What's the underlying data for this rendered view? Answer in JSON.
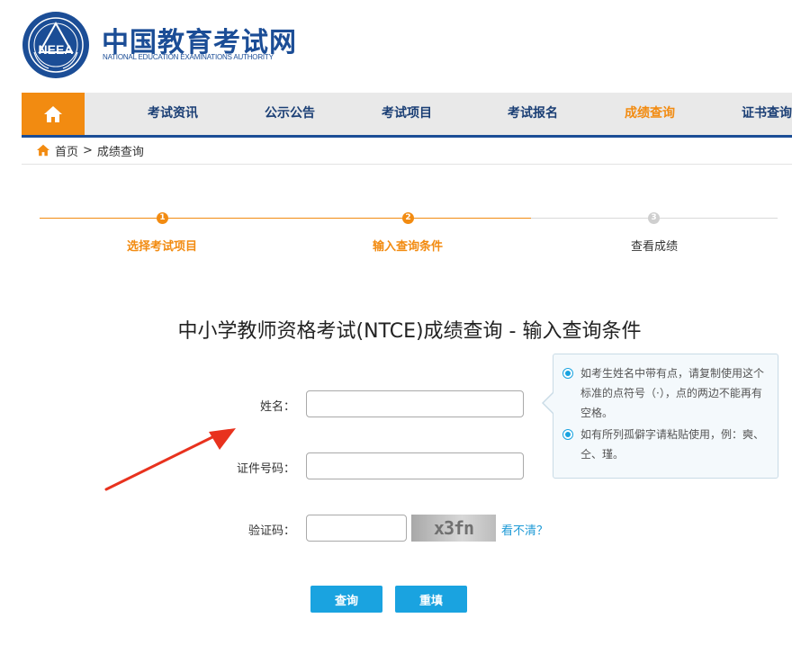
{
  "brand": {
    "name_cn": "中国教育考试网",
    "name_en": "NATIONAL EDUCATION EXAMINATIONS AUTHORITY",
    "seal_text": "NEEA"
  },
  "nav": {
    "home_icon": "home-icon",
    "items": [
      {
        "label": "考试资讯",
        "active": false
      },
      {
        "label": "公示公告",
        "active": false
      },
      {
        "label": "考试项目",
        "active": false
      },
      {
        "label": "考试报名",
        "active": false
      },
      {
        "label": "成绩查询",
        "active": true
      },
      {
        "label": "证书查询",
        "active": false
      }
    ]
  },
  "breadcrumb": {
    "home": "首页",
    "separator": ">",
    "current": "成绩查询"
  },
  "steps": [
    {
      "number": "1",
      "label": "选择考试项目",
      "state": "done"
    },
    {
      "number": "2",
      "label": "输入查询条件",
      "state": "current"
    },
    {
      "number": "3",
      "label": "查看成绩",
      "state": "pending"
    }
  ],
  "form": {
    "title": "中小学教师资格考试(NTCE)成绩查询 - 输入查询条件",
    "name_label": "姓名：",
    "name_value": "",
    "id_label": "证件号码：",
    "id_value": "",
    "captcha_label": "验证码：",
    "captcha_value": "",
    "captcha_image_text": "x3fn",
    "captcha_refresh": "看不清？",
    "submit_label": "查询",
    "reset_label": "重填"
  },
  "tips": [
    "如考生姓名中带有点，请复制使用这个标准的点符号（·），点的两边不能再有空格。",
    "如有所列孤僻字请粘贴使用，例：奭、仝、瑾。"
  ],
  "colors": {
    "brand_blue": "#1b4d96",
    "accent_orange": "#f28b11",
    "button_blue": "#1aa3e0",
    "nav_bg": "#e9e9e9",
    "annotation_red": "#e8321e"
  }
}
